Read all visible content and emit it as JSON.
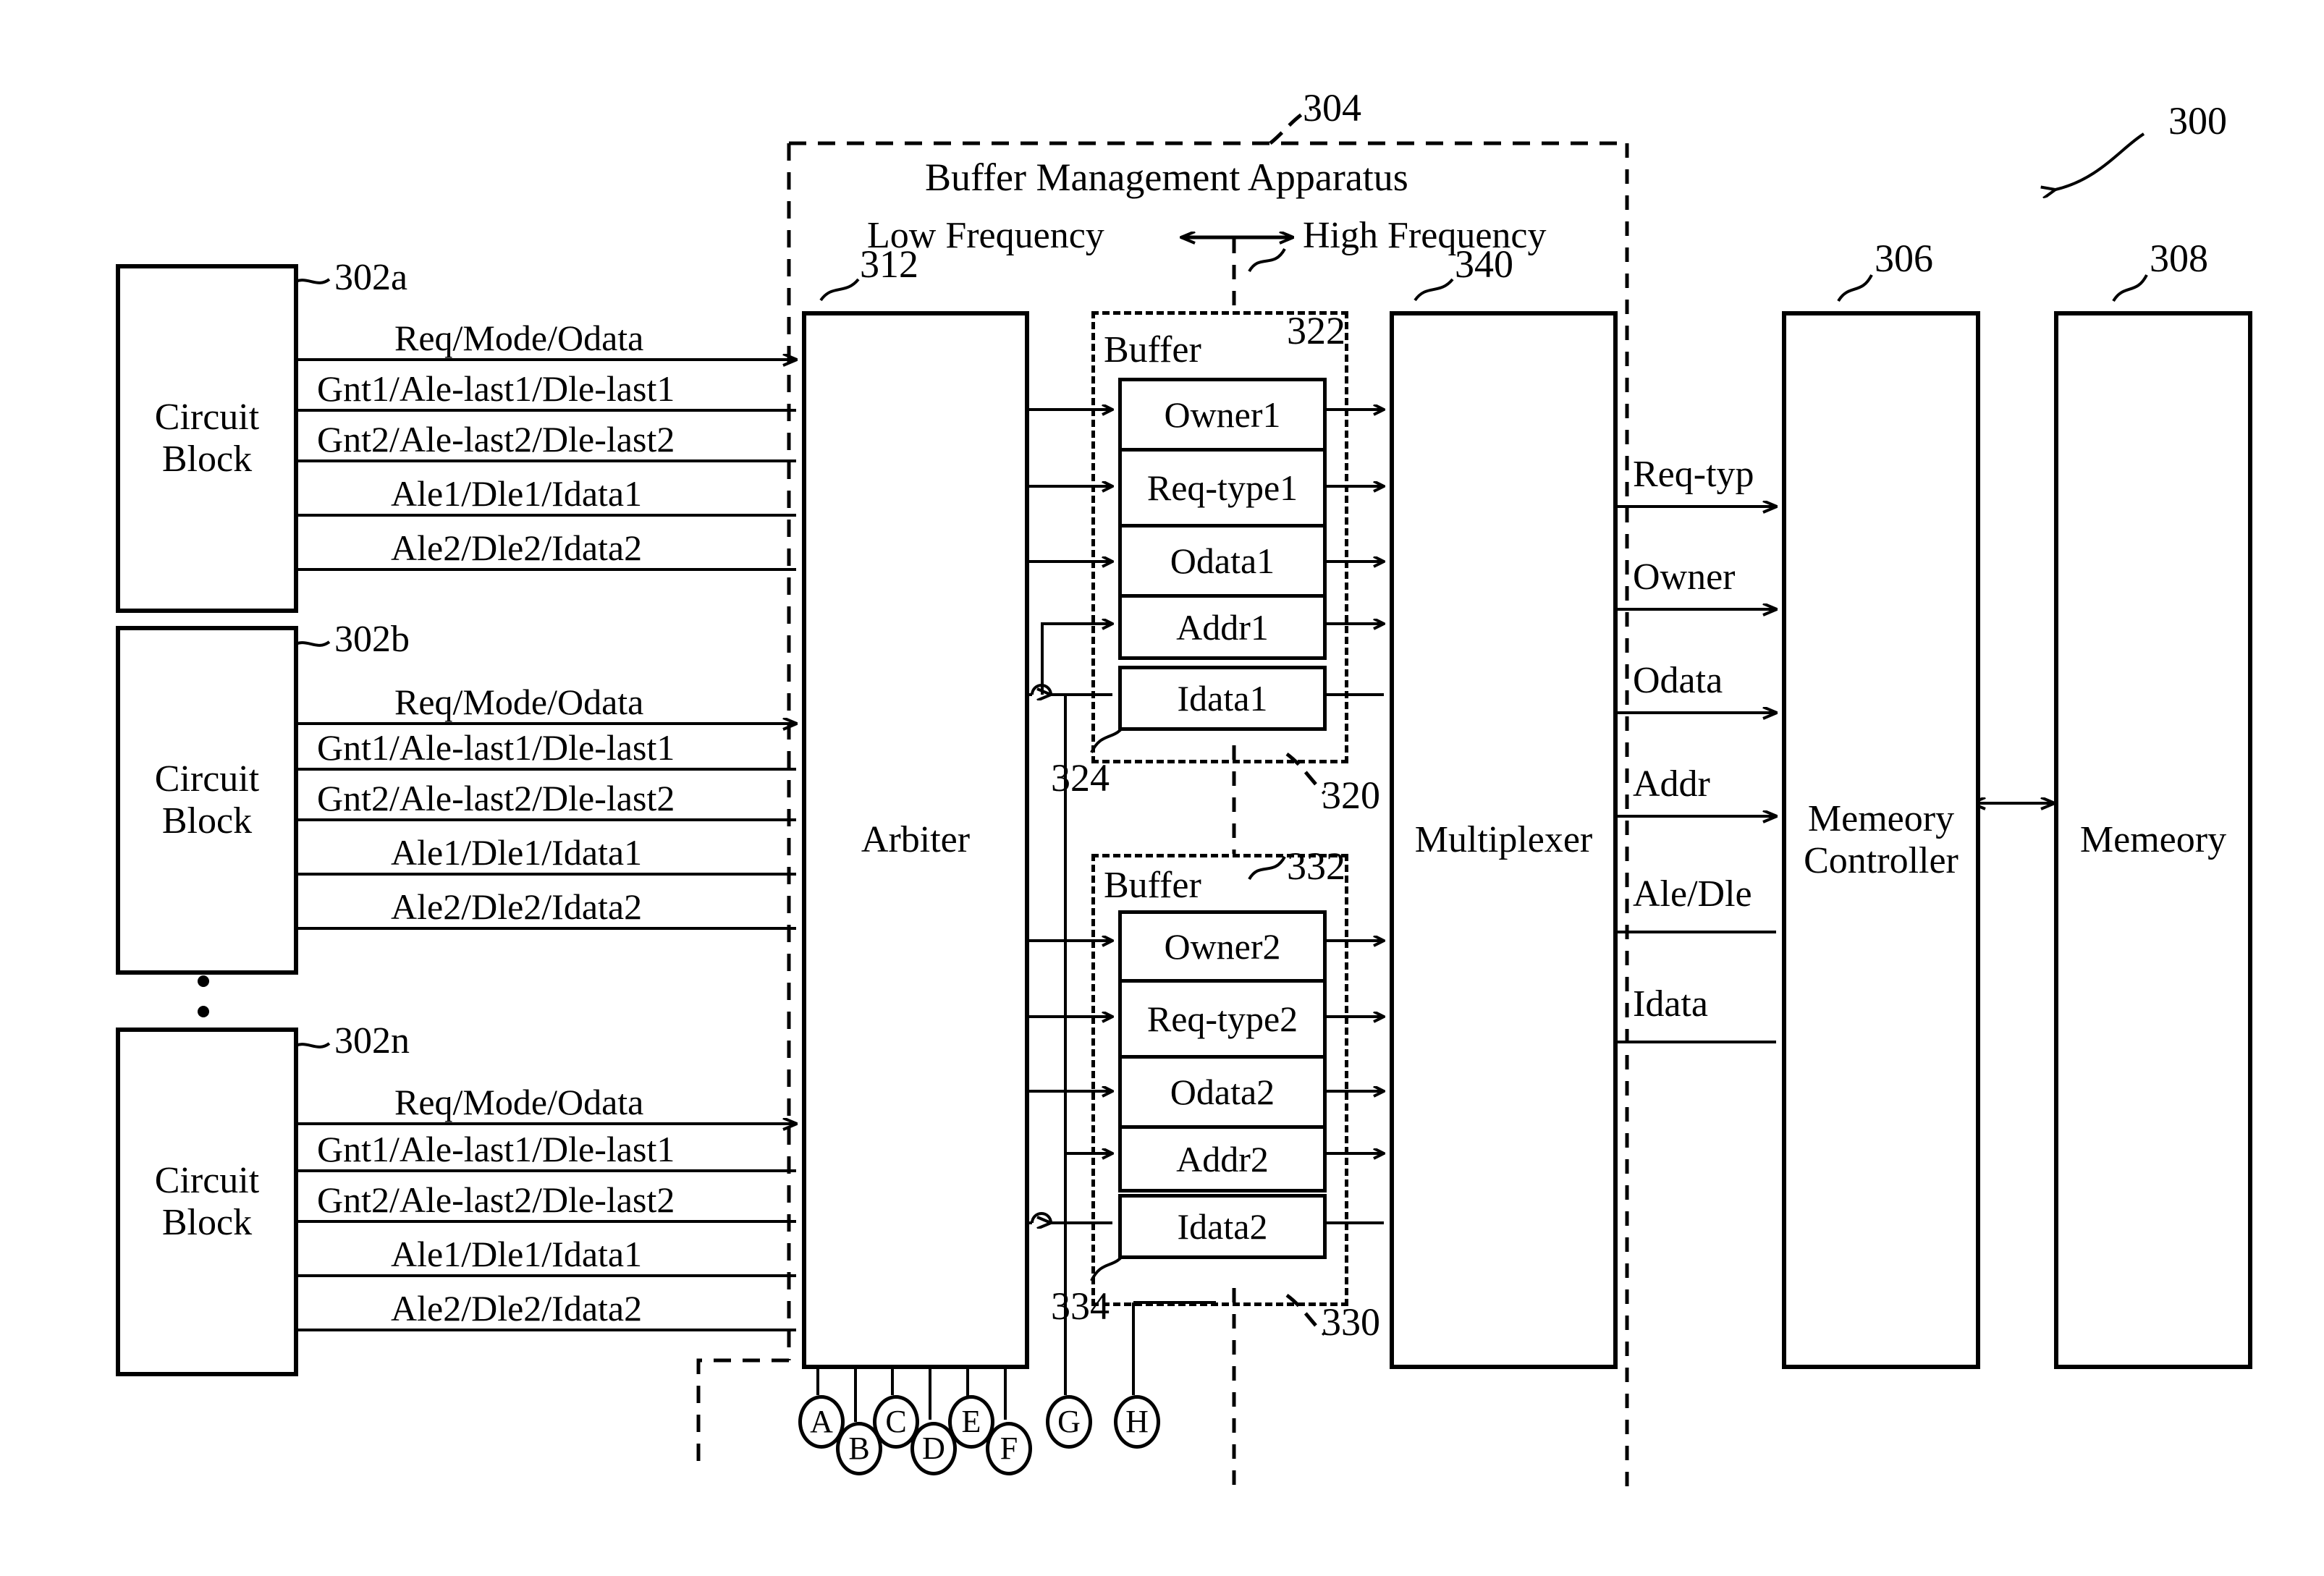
{
  "figure": {
    "system_ref": "300",
    "apparatus": {
      "ref": "304",
      "title": "Buffer Management Apparatus",
      "frequency_left": "Low Frequency",
      "frequency_right": "High Frequency"
    }
  },
  "circuit_blocks": [
    {
      "ref": "302a",
      "label_line1": "Circuit",
      "label_line2": "Block",
      "signals": [
        {
          "name": "Req/Mode/Odata",
          "direction": "right"
        },
        {
          "name": "Gnt1/Ale-last1/Dle-last1",
          "direction": "left"
        },
        {
          "name": "Gnt2/Ale-last2/Dle-last2",
          "direction": "left"
        },
        {
          "name": "Ale1/Dle1/Idata1",
          "direction": "left"
        },
        {
          "name": "Ale2/Dle2/Idata2",
          "direction": "left"
        }
      ]
    },
    {
      "ref": "302b",
      "label_line1": "Circuit",
      "label_line2": "Block",
      "signals": [
        {
          "name": "Req/Mode/Odata",
          "direction": "right"
        },
        {
          "name": "Gnt1/Ale-last1/Dle-last1",
          "direction": "left"
        },
        {
          "name": "Gnt2/Ale-last2/Dle-last2",
          "direction": "left"
        },
        {
          "name": "Ale1/Dle1/Idata1",
          "direction": "left"
        },
        {
          "name": "Ale2/Dle2/Idata2",
          "direction": "left"
        }
      ]
    },
    {
      "ref": "302n",
      "label_line1": "Circuit",
      "label_line2": "Block",
      "signals": [
        {
          "name": "Req/Mode/Odata",
          "direction": "right"
        },
        {
          "name": "Gnt1/Ale-last1/Dle-last1",
          "direction": "left"
        },
        {
          "name": "Gnt2/Ale-last2/Dle-last2",
          "direction": "left"
        },
        {
          "name": "Ale1/Dle1/Idata1",
          "direction": "left"
        },
        {
          "name": "Ale2/Dle2/Idata2",
          "direction": "left"
        }
      ]
    }
  ],
  "arbiter": {
    "ref": "312",
    "label": "Arbiter"
  },
  "buffers": [
    {
      "ref_buffer": "322",
      "ref_group": "320",
      "ref_idata": "324",
      "caption": "Buffer",
      "fields": [
        "Owner1",
        "Req-type1",
        "Odata1",
        "Addr1"
      ],
      "idata": "Idata1"
    },
    {
      "ref_buffer": "332",
      "ref_group": "330",
      "ref_idata": "334",
      "caption": "Buffer",
      "fields": [
        "Owner2",
        "Req-type2",
        "Odata2",
        "Addr2"
      ],
      "idata": "Idata2"
    }
  ],
  "multiplexer": {
    "ref": "340",
    "label": "Multiplexer"
  },
  "memory_controller": {
    "ref": "306",
    "label_line1": "Memeory",
    "label_line2": "Controller"
  },
  "memory": {
    "ref": "308",
    "label": "Memeory"
  },
  "controller_signals": [
    {
      "name": "Req-typ",
      "direction": "right"
    },
    {
      "name": "Owner",
      "direction": "right"
    },
    {
      "name": "Odata",
      "direction": "right"
    },
    {
      "name": "Addr",
      "direction": "right"
    },
    {
      "name": "Ale/Dle",
      "direction": "left"
    },
    {
      "name": "Idata",
      "direction": "left"
    }
  ],
  "connector_tags": [
    "A",
    "B",
    "C",
    "D",
    "E",
    "F",
    "G",
    "H"
  ],
  "ellipsis_dots": 2
}
